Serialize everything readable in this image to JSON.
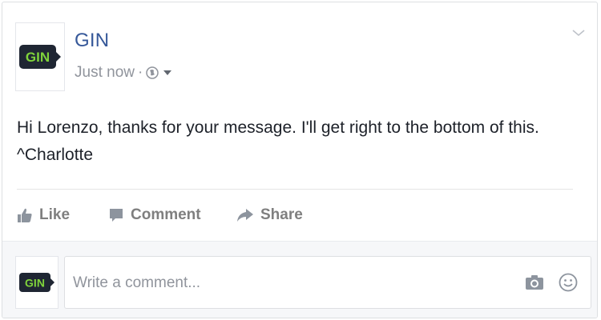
{
  "post": {
    "page_name": "GIN",
    "avatar_text": "GIN",
    "timestamp": "Just now",
    "separator": "·",
    "audience_icon": "globe-icon",
    "message_line1": "Hi Lorenzo, thanks for your message. I'll get right to the bottom of this.",
    "message_line2": "^Charlotte"
  },
  "actions": {
    "like_label": "Like",
    "comment_label": "Comment",
    "share_label": "Share"
  },
  "comment_composer": {
    "avatar_text": "GIN",
    "placeholder": "Write a comment...",
    "camera_icon": "camera-icon",
    "emoji_icon": "smiley-icon"
  },
  "colors": {
    "brand_green": "#7fd33b",
    "avatar_dark": "#1f2633",
    "link_blue": "#365899",
    "muted_gray": "#90949c"
  }
}
